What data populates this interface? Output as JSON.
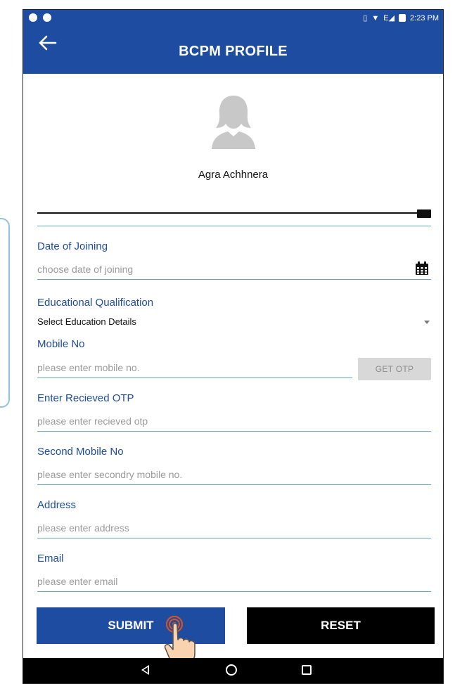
{
  "status_bar": {
    "time": "2:23 PM"
  },
  "header": {
    "title": "BCPM PROFILE",
    "back_icon": "arrow-left-icon"
  },
  "profile": {
    "name": "Agra Achhnera"
  },
  "form": {
    "date_of_joining": {
      "label": "Date of Joining",
      "placeholder": "choose date of joining"
    },
    "education": {
      "label": "Educational Qualification",
      "selected": "Select Education Details"
    },
    "mobile": {
      "label": "Mobile No",
      "placeholder": "please enter mobile no.",
      "otp_button": "GET OTP"
    },
    "otp": {
      "label": "Enter Recieved OTP",
      "placeholder": "please enter recieved otp"
    },
    "second_mobile": {
      "label": "Second Mobile No",
      "placeholder": "please enter secondry mobile no."
    },
    "address": {
      "label": "Address",
      "placeholder": "please enter address"
    },
    "email": {
      "label": "Email",
      "placeholder": "please enter email"
    }
  },
  "actions": {
    "submit": "SUBMIT",
    "reset": "RESET"
  },
  "colors": {
    "primary": "#1e4ca0",
    "underline": "#5ea3e6",
    "reset_bg": "#000000"
  }
}
